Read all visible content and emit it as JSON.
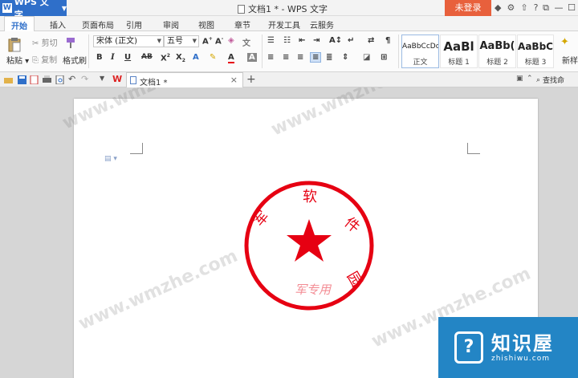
{
  "titlebar": {
    "app_name": "WPS 文字",
    "doc_title": "文档1 * - WPS 文字",
    "login_label": "未登录",
    "help_label": "?"
  },
  "menu": {
    "tabs": [
      "开始",
      "插入",
      "页面布局",
      "引用",
      "审阅",
      "视图",
      "章节",
      "开发工具",
      "云服务"
    ]
  },
  "ribbon": {
    "paste": "粘贴",
    "cut": "剪切",
    "copy": "复制",
    "format_painter": "格式刷",
    "font_name": "宋体 (正文)",
    "font_size": "五号",
    "styles": [
      {
        "sample": "AaBbCcDd",
        "name": "正文"
      },
      {
        "sample": "AaBl",
        "name": "标题 1"
      },
      {
        "sample": "AaBb(",
        "name": "标题 2"
      },
      {
        "sample": "AaBbC",
        "name": "标题 3"
      }
    ],
    "new_style": "新样"
  },
  "quickbar": {
    "doc_tab": "文档1 *",
    "find_label": "查找命"
  },
  "document": {
    "seal": {
      "color": "#e60012",
      "top_text": [
        "军",
        "软",
        "件"
      ],
      "bottom_text": "军专用",
      "right_char": "园"
    }
  },
  "watermark_text": "www.wmzhe.com",
  "brand": {
    "name": "知识屋",
    "url": "zhishiwu.com",
    "color": "#2385c5"
  }
}
